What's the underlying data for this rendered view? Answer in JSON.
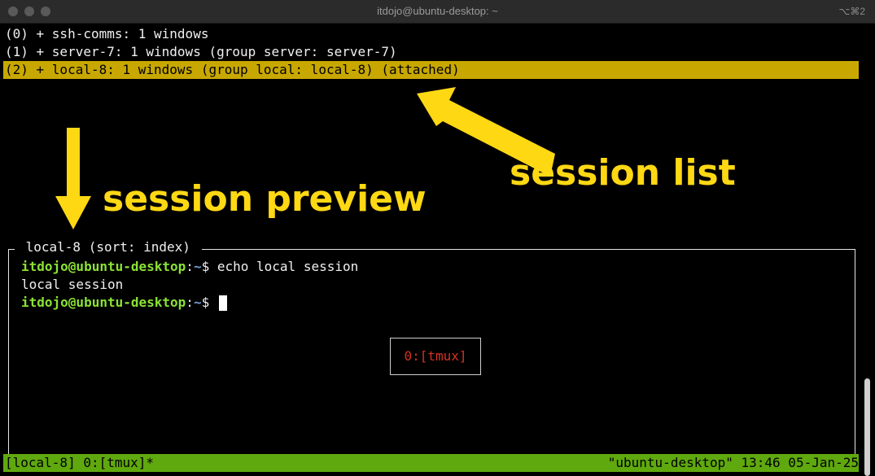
{
  "window": {
    "title": "itdojo@ubuntu-desktop: ~",
    "shortcut": "⌥⌘2"
  },
  "session_list": {
    "items": [
      {
        "text": "(0) + ssh-comms: 1 windows"
      },
      {
        "text": "(1) + server-7: 1 windows (group server: server-7)"
      },
      {
        "text": "(2) + local-8: 1 windows (group local: local-8) (attached)",
        "selected": true
      }
    ]
  },
  "annotations": {
    "session_list_label": "session list",
    "session_preview_label": "session preview",
    "color": "#ffd814"
  },
  "preview": {
    "title": " local-8 (sort: index) ",
    "prompt_user": "itdojo@ubuntu-desktop",
    "prompt_sep": ":",
    "prompt_path": "~",
    "prompt_symbol": "$",
    "command": " echo local session",
    "output": "local session",
    "window_label": "0:[tmux]"
  },
  "status_bar": {
    "left": "[local-8] 0:[tmux]*",
    "right": "\"ubuntu-desktop\" 13:46 05-Jan-25",
    "color": "#5fa80e"
  }
}
